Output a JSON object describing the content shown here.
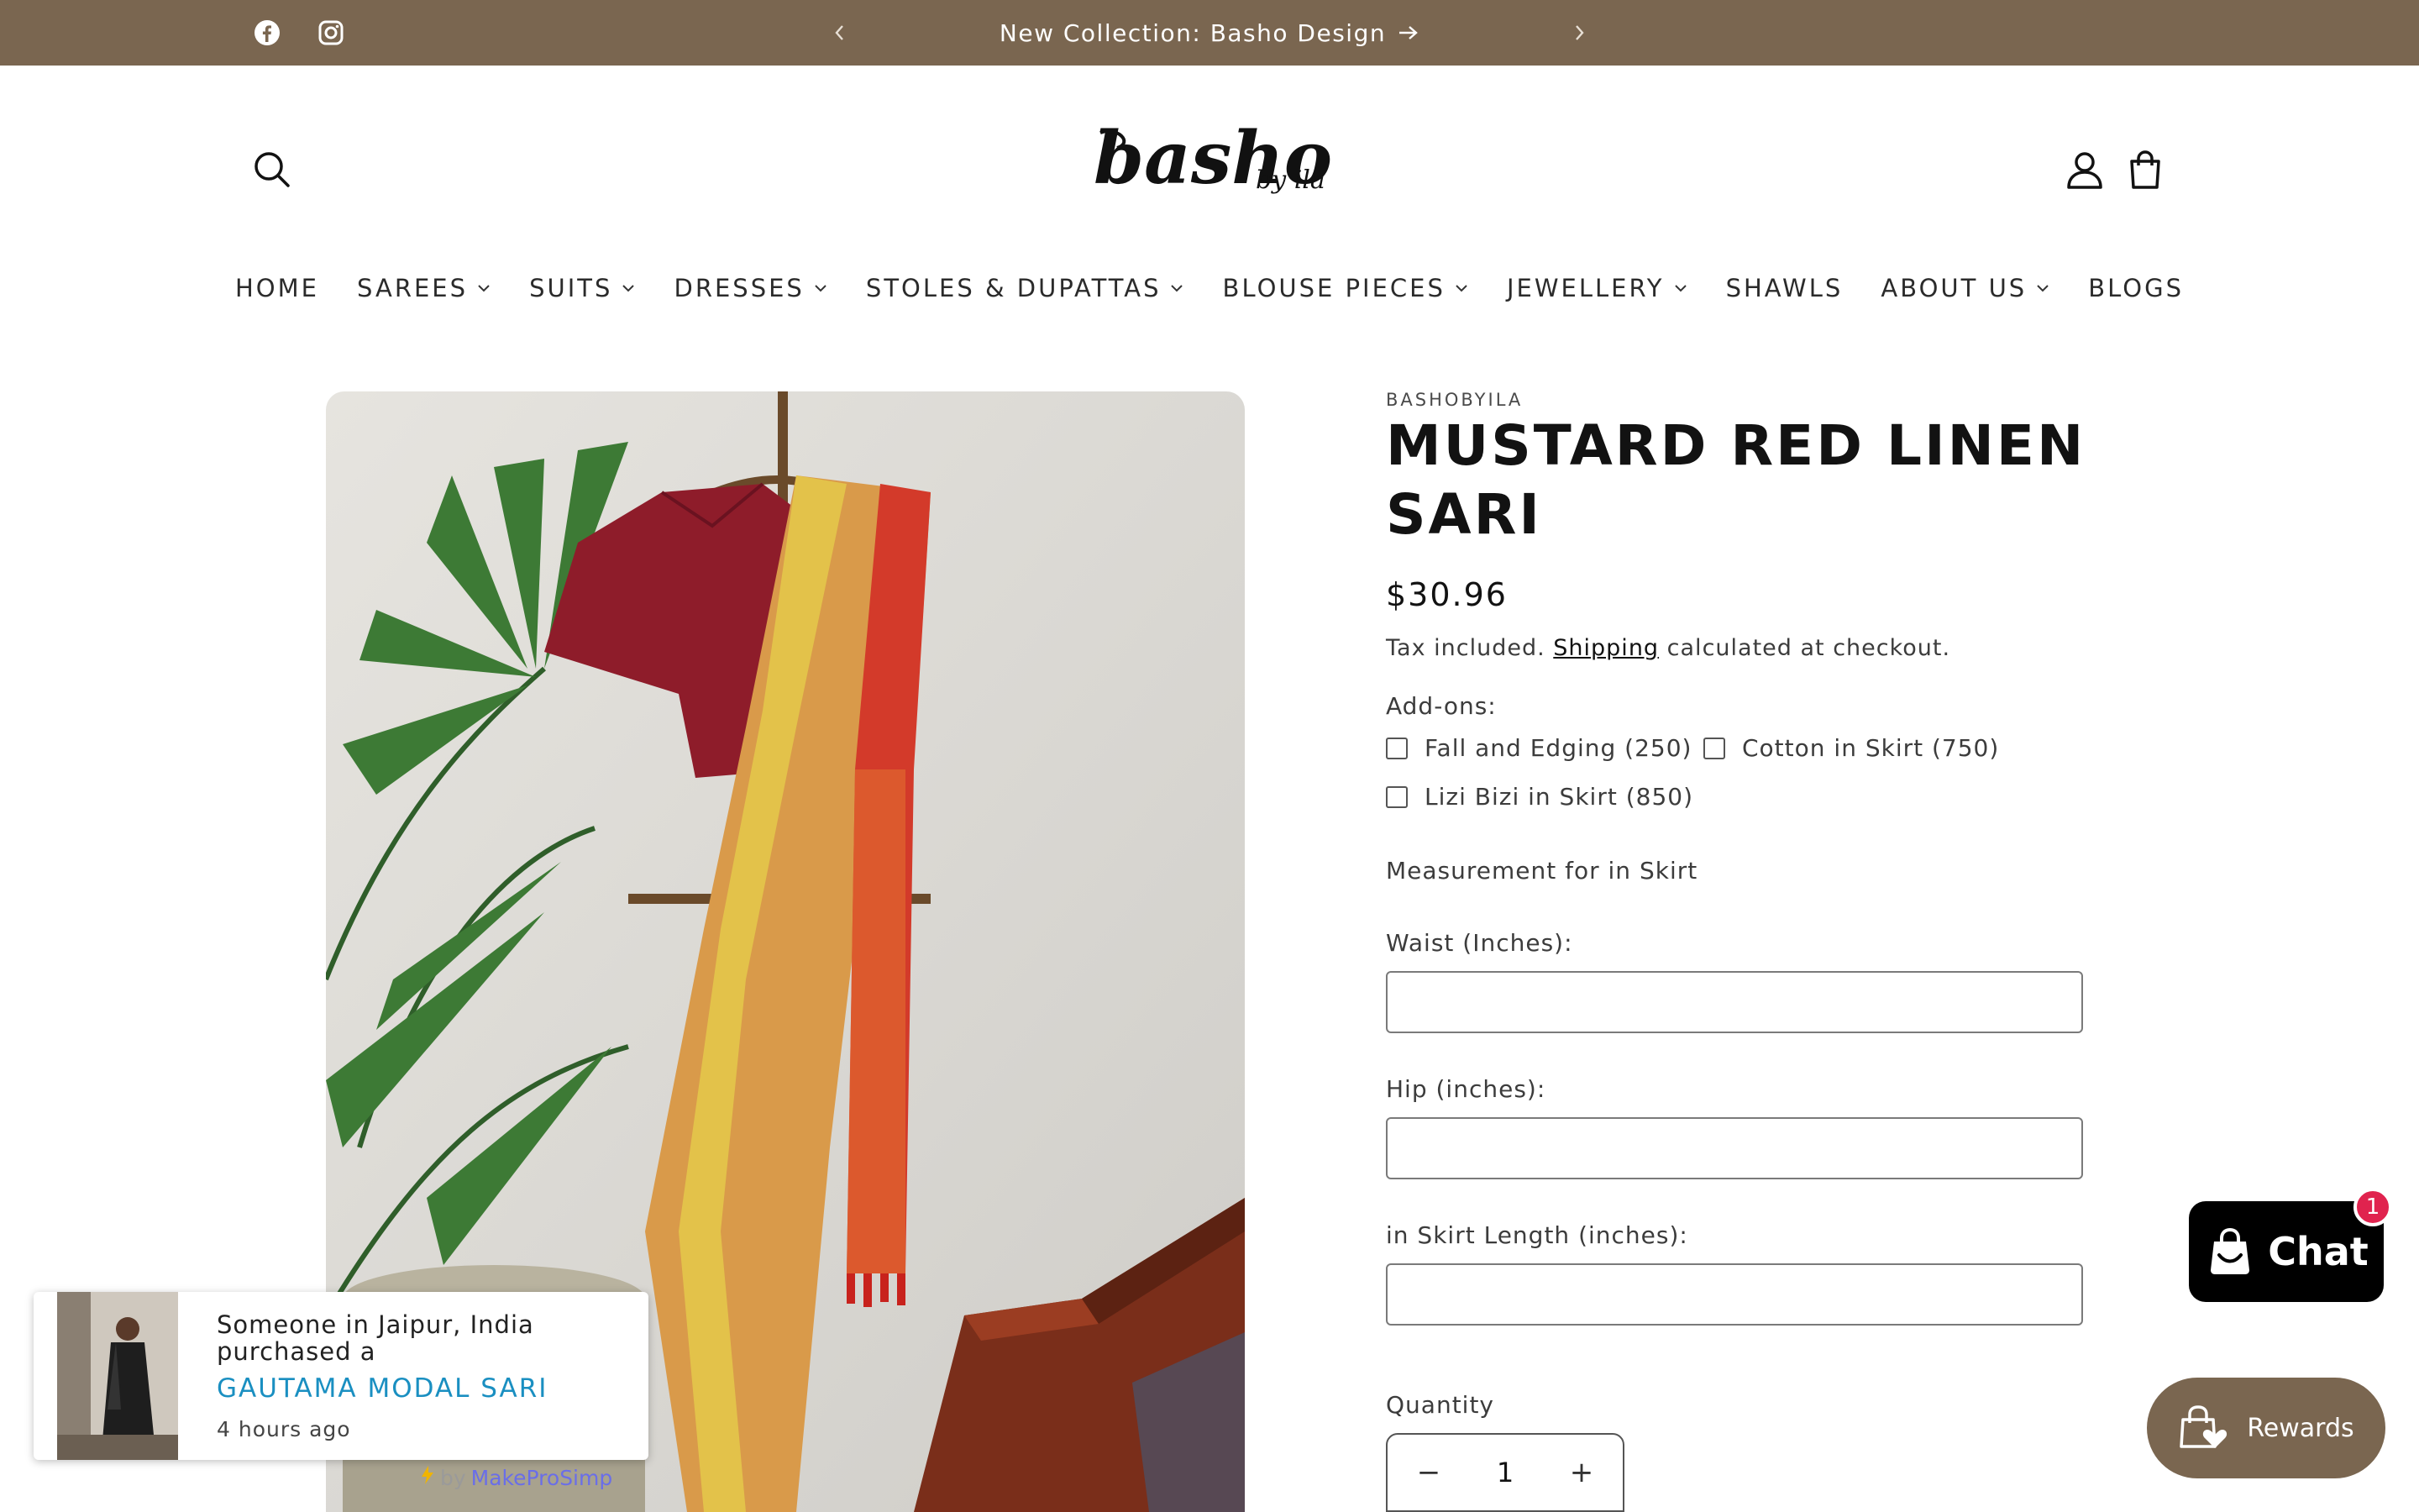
{
  "announcement": {
    "message": "New Collection: Basho Design",
    "bg_color": "#7a6650"
  },
  "header": {
    "logo_text": "basho",
    "logo_sub": "by ila",
    "icons": [
      "facebook-icon",
      "instagram-icon",
      "search-icon",
      "account-icon",
      "cart-icon"
    ]
  },
  "nav": {
    "items": [
      {
        "label": "HOME",
        "has_dropdown": false
      },
      {
        "label": "SAREES",
        "has_dropdown": true
      },
      {
        "label": "SUITS",
        "has_dropdown": true
      },
      {
        "label": "DRESSES",
        "has_dropdown": true
      },
      {
        "label": "STOLES & DUPATTAS",
        "has_dropdown": true
      },
      {
        "label": "BLOUSE PIECES",
        "has_dropdown": true
      },
      {
        "label": "JEWELLERY",
        "has_dropdown": true
      },
      {
        "label": "SHAWLS",
        "has_dropdown": false
      },
      {
        "label": "ABOUT US",
        "has_dropdown": true
      },
      {
        "label": "BLOGS",
        "has_dropdown": false
      }
    ]
  },
  "product": {
    "vendor": "BASHOBYILA",
    "title_line1": "MUSTARD RED LINEN",
    "title_line2": "SARI",
    "price": "$30.96",
    "tax_prefix": "Tax included.",
    "shipping_link": "Shipping",
    "tax_suffix": "calculated at checkout.",
    "addons_label": "Add-ons:",
    "addons": [
      {
        "label": "Fall and Edging (250)",
        "checked": false
      },
      {
        "label": "Cotton in Skirt (750)",
        "checked": false
      },
      {
        "label": "Lizi Bizi in Skirt (850)",
        "checked": false
      }
    ],
    "measurement_heading": "Measurement for in Skirt",
    "fields": [
      {
        "label": "Waist (Inches):",
        "value": ""
      },
      {
        "label": "Hip (inches):",
        "value": ""
      },
      {
        "label": "in Skirt Length (inches):",
        "value": ""
      }
    ],
    "quantity_label": "Quantity",
    "quantity": "1"
  },
  "chat": {
    "label": "Chat",
    "badge": "1"
  },
  "rewards": {
    "label": "Rewards"
  },
  "popup": {
    "message": "Someone in Jaipur, India purchased a",
    "product": "GAUTAMA MODAL SARI",
    "time": "4 hours ago",
    "powered_by": "by",
    "powered_brand": "MakeProSimp"
  }
}
